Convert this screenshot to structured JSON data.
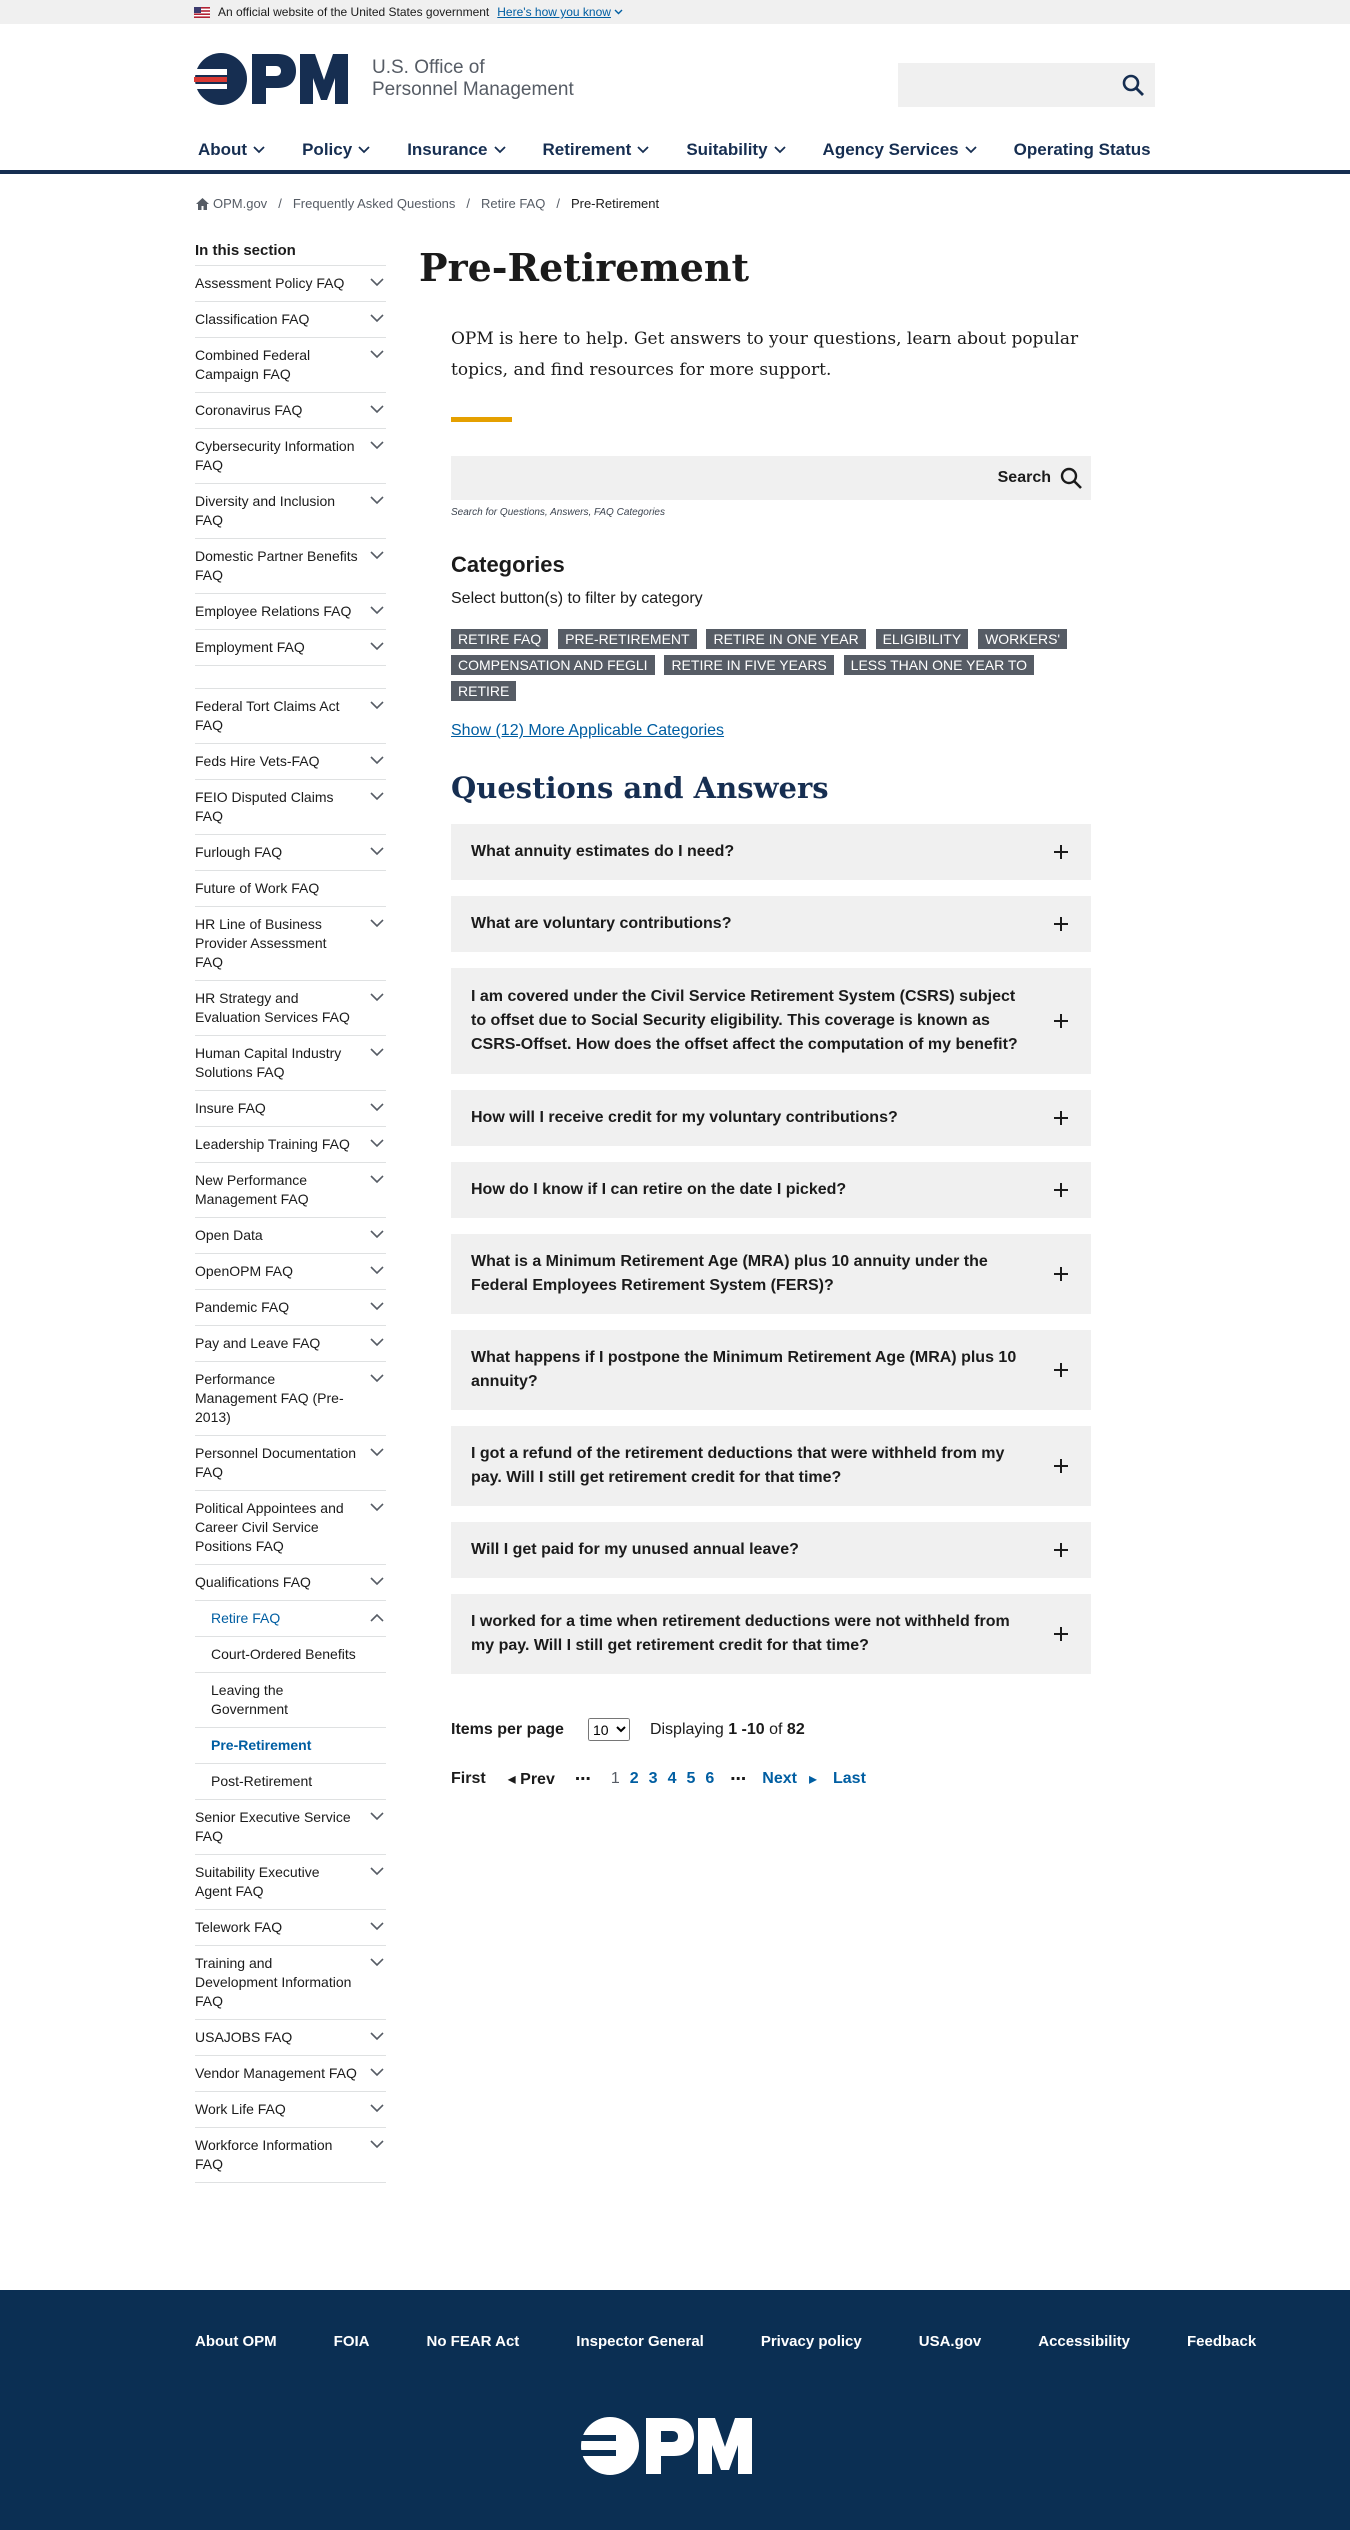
{
  "banner": {
    "text": "An official website of the United States government",
    "link": "Here's how you know"
  },
  "header": {
    "logo_text": "OPM",
    "agency_line1": "U.S. Office of",
    "agency_line2": "Personnel Management",
    "search_icon": "search-icon"
  },
  "nav": {
    "items": [
      "About",
      "Policy",
      "Insurance",
      "Retirement",
      "Suitability",
      "Agency Services",
      "Operating Status"
    ]
  },
  "breadcrumb": [
    "OPM.gov",
    "Frequently Asked Questions",
    "Retire FAQ",
    "Pre-Retirement"
  ],
  "sidebar": {
    "heading": "In this section",
    "items": [
      "Assessment Policy FAQ",
      "Classification FAQ",
      "Combined Federal Campaign FAQ",
      "Coronavirus FAQ",
      "Cybersecurity Information FAQ",
      "Diversity and Inclusion FAQ",
      "Domestic Partner Benefits FAQ",
      "Employee Relations FAQ",
      "Employment FAQ",
      "",
      "Federal Tort Claims Act FAQ",
      "Feds Hire Vets-FAQ",
      "FEIO Disputed Claims FAQ",
      "Furlough FAQ",
      "Future of Work FAQ",
      "HR Line of Business Provider Assessment FAQ",
      "HR Strategy and Evaluation Services FAQ",
      "Human Capital Industry Solutions FAQ",
      "Insure FAQ",
      "Leadership Training FAQ",
      "New Performance Management FAQ",
      "Open Data",
      "OpenOPM FAQ",
      "Pandemic FAQ",
      "Pay and Leave FAQ",
      "Performance Management FAQ (Pre-2013)",
      "Personnel Documentation FAQ",
      "Political Appointees and Career Civil Service Positions FAQ",
      "Qualifications FAQ"
    ],
    "active": "Retire FAQ",
    "sub_items": [
      "Court-Ordered Benefits",
      "Leaving the Government",
      "Pre-Retirement",
      "Post-Retirement"
    ],
    "items_after": [
      "Senior Executive Service FAQ",
      "Suitability Executive Agent FAQ",
      "Telework FAQ",
      "Training and Development Information FAQ",
      "USAJOBS FAQ",
      "Vendor Management FAQ",
      "Work Life FAQ",
      "Workforce Information FAQ"
    ]
  },
  "main": {
    "title": "Pre-Retirement",
    "intro": "OPM is here to help. Get answers to your questions, learn about popular topics, and find resources for more support.",
    "search_label": "Search",
    "search_hint": "Search for Questions, Answers, FAQ Categories",
    "categories_heading": "Categories",
    "categories_sub": "Select button(s) to filter by category",
    "tags": [
      "RETIRE FAQ",
      "PRE-RETIREMENT",
      "RETIRE IN ONE YEAR",
      "ELIGIBILITY",
      "WORKERS' COMPENSATION AND FEGLI",
      "RETIRE IN FIVE YEARS",
      "LESS THAN ONE YEAR TO RETIRE"
    ],
    "more_link": "Show (12) More Applicable Categories",
    "qa_heading": "Questions and Answers",
    "questions": [
      "What annuity estimates do I need?",
      "What are voluntary contributions?",
      "I am covered under the Civil Service Retirement System (CSRS) subject to offset due to Social Security eligibility. This coverage is known as CSRS-Offset. How does the offset affect the computation of my benefit?",
      "How will I receive credit for my voluntary contributions?",
      "How do I know if I can retire on the date I picked?",
      "What is a Minimum Retirement Age (MRA) plus 10 annuity under the Federal Employees Retirement System (FERS)?",
      "What happens if I postpone the Minimum Retirement Age (MRA) plus 10 annuity?",
      "I got a refund of the retirement deductions that were withheld from my pay. Will I still get retirement credit for that time?",
      "Will I get paid for my unused annual leave?",
      "I worked for a time when retirement deductions were not withheld from my pay. Will I still get retirement credit for that time?"
    ]
  },
  "pager": {
    "items_label": "Items per page",
    "per_page": "10",
    "displaying": "Displaying",
    "range": "1 -10",
    "of": "of",
    "total": "82",
    "first": "First",
    "prev": "◂ Prev",
    "ellipsis": "⋯",
    "pages": [
      "1",
      "2",
      "3",
      "4",
      "5",
      "6"
    ],
    "current": "1",
    "next": "Next",
    "next_arrow": "▸",
    "last": "Last"
  },
  "footer": {
    "links": [
      "About OPM",
      "FOIA",
      "No FEAR Act",
      "Inspector General",
      "Privacy policy",
      "USA.gov",
      "Accessibility",
      "Feedback"
    ],
    "logo_text": "OPM"
  },
  "colors": {
    "navy": "#162e51",
    "link": "#005ea2",
    "accent": "#e5a000",
    "footer": "#0b2f53",
    "logo_red": "#d83933"
  }
}
